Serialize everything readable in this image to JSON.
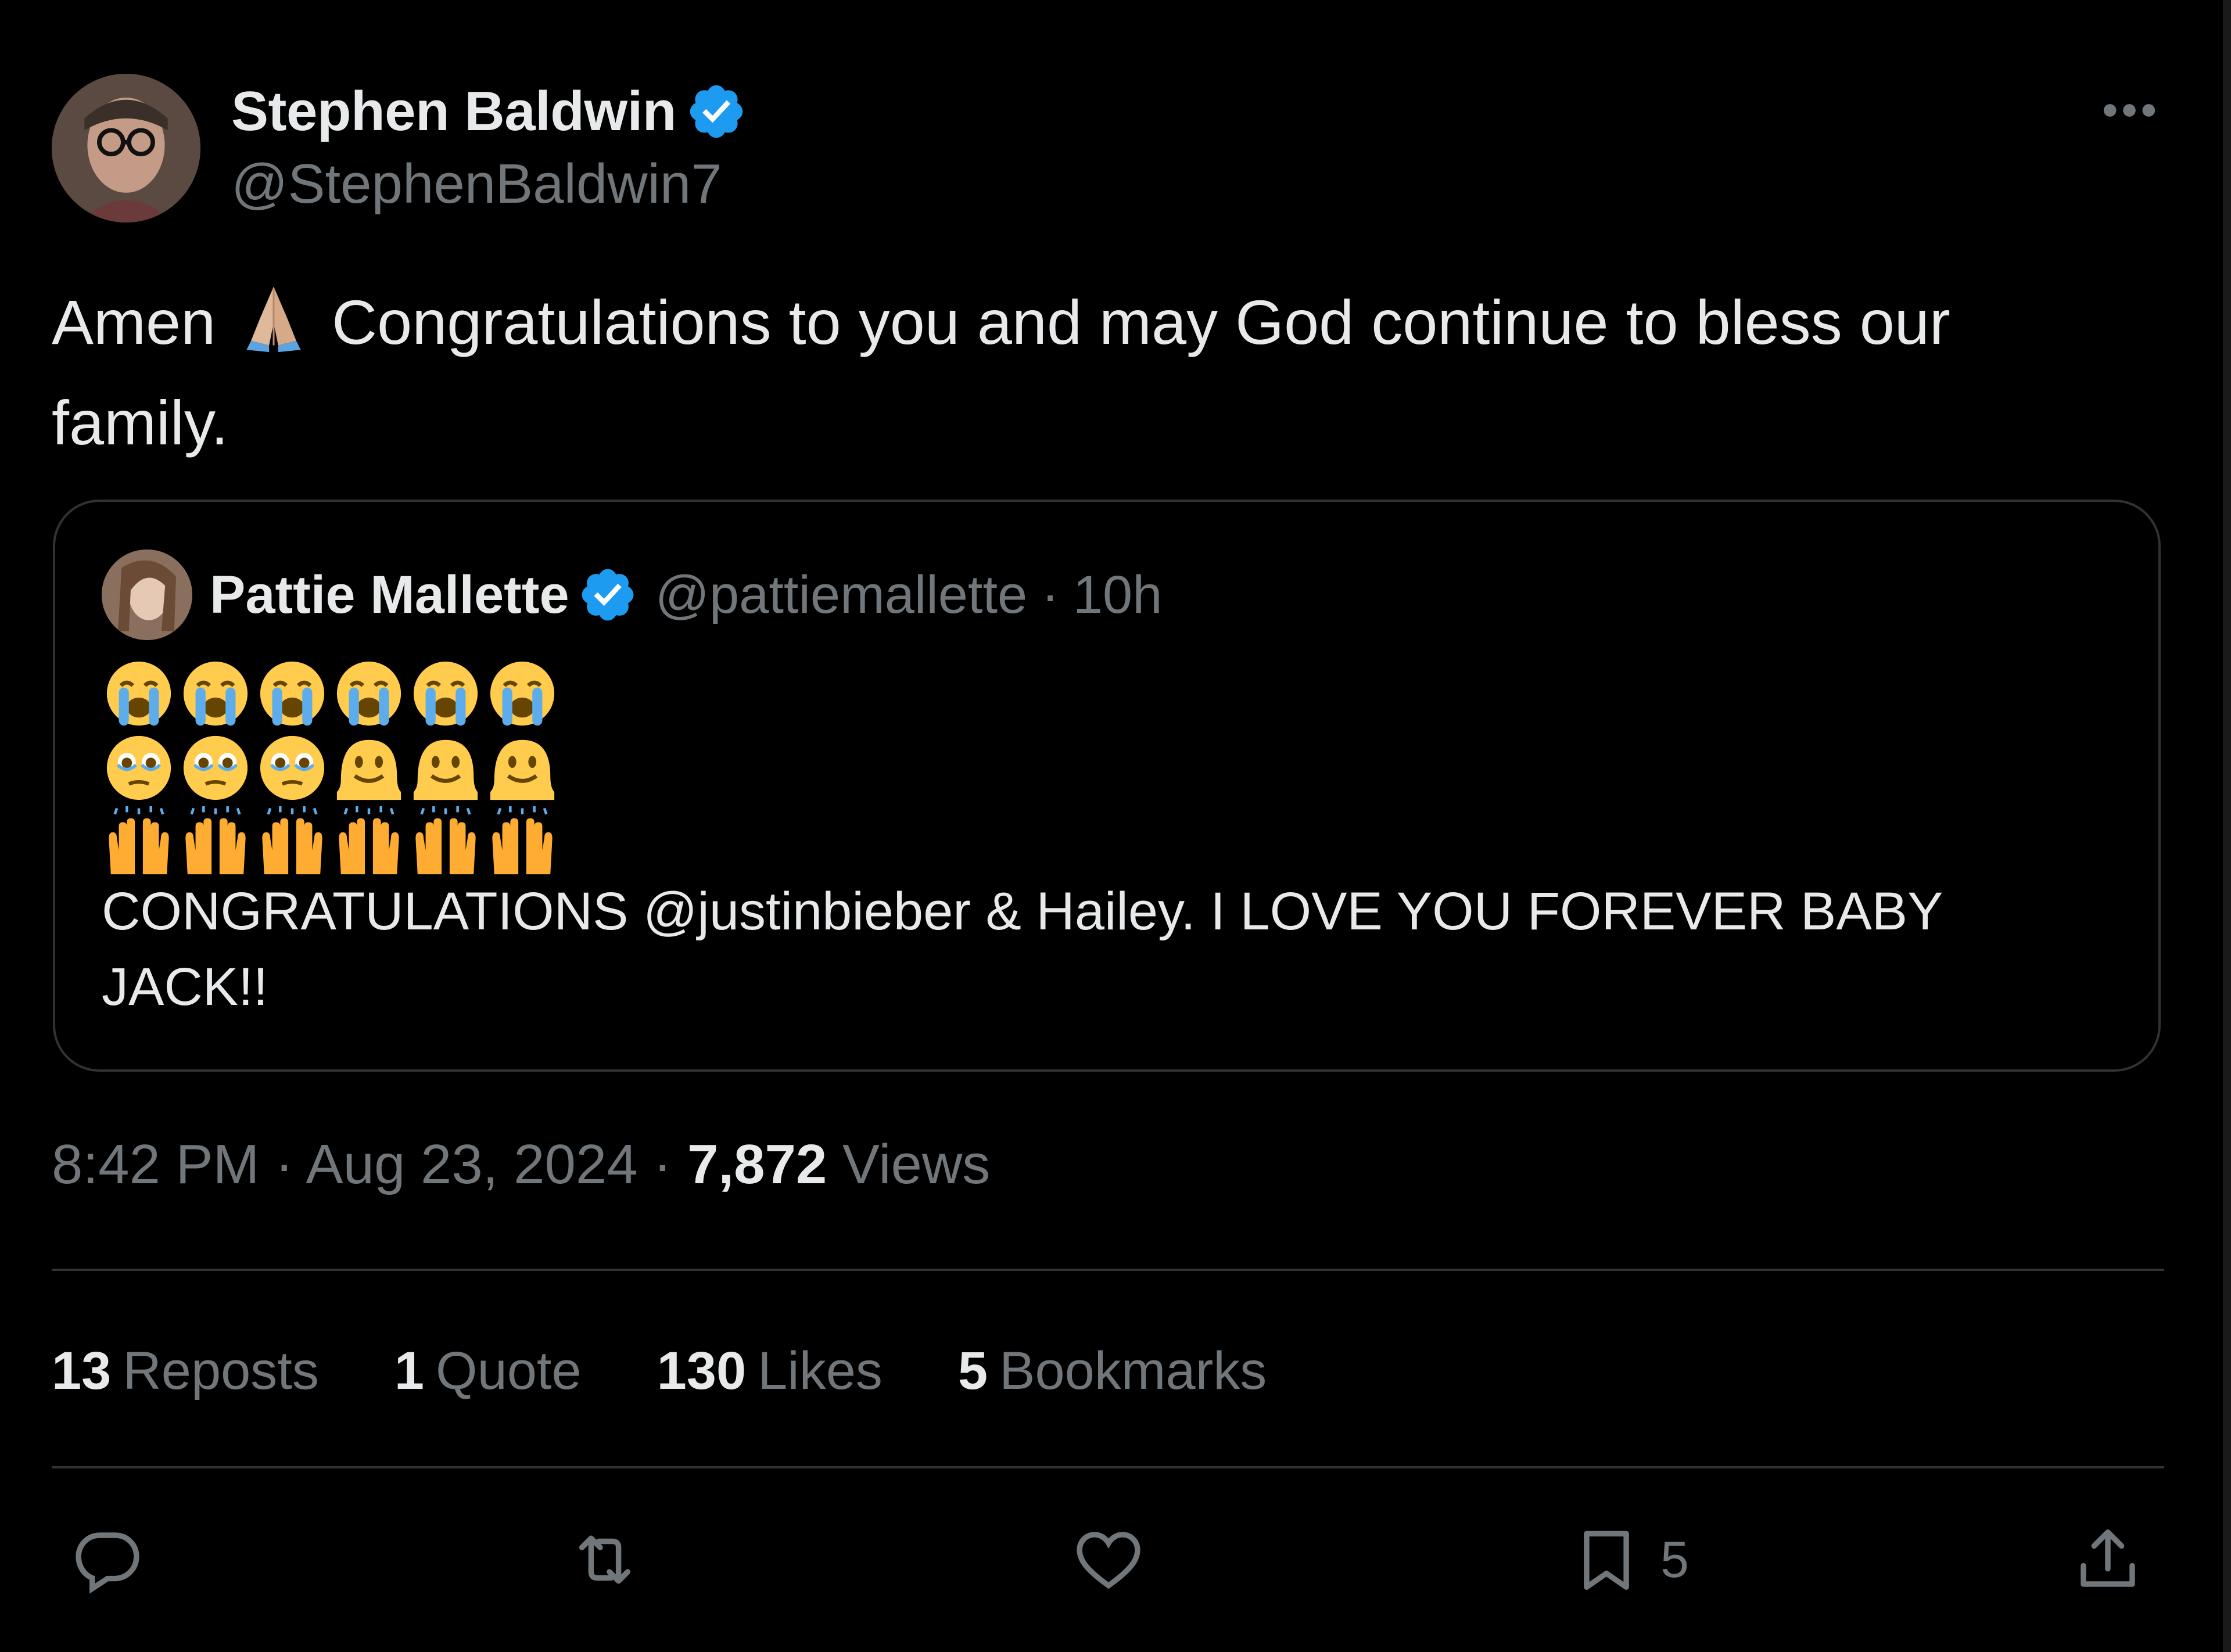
{
  "post": {
    "author": {
      "display_name": "Stephen Baldwin",
      "handle": "@StephenBaldwin7",
      "verified": true
    },
    "text_before_emoji": "Amen ",
    "inline_emoji": "folded-hands-emoji",
    "text_after_emoji": " Congratulations to you and may God continue to bless our family.",
    "timestamp_time": "8:42 PM",
    "timestamp_date": "Aug 23, 2024",
    "views_count": "7,872",
    "views_label": "Views"
  },
  "quote": {
    "author": {
      "display_name": "Pattie Mallette",
      "handle": "@pattiemallette",
      "verified": true
    },
    "time_ago": "10h",
    "emoji_rows": [
      [
        "loudly-crying-face",
        "loudly-crying-face",
        "loudly-crying-face",
        "loudly-crying-face",
        "loudly-crying-face",
        "loudly-crying-face"
      ],
      [
        "face-holding-back-tears",
        "face-holding-back-tears",
        "face-holding-back-tears",
        "melting-face",
        "melting-face",
        "melting-face"
      ],
      [
        "raising-hands",
        "raising-hands",
        "raising-hands",
        "raising-hands",
        "raising-hands",
        "raising-hands"
      ]
    ],
    "text": "CONGRATULATIONS @justinbieber & Hailey. I LOVE YOU FOREVER BABY JACK!!"
  },
  "stats": {
    "reposts_count": "13",
    "reposts_label": "Reposts",
    "quotes_count": "1",
    "quotes_label": "Quote",
    "likes_count": "130",
    "likes_label": "Likes",
    "bookmarks_count": "5",
    "bookmarks_label": "Bookmarks"
  },
  "actions": {
    "bookmark_count": "5"
  },
  "colors": {
    "background": "#000000",
    "primary_text": "#e7e9ea",
    "secondary_text": "#71767b",
    "border": "#2f3336",
    "verified_blue": "#1d9bf0"
  }
}
